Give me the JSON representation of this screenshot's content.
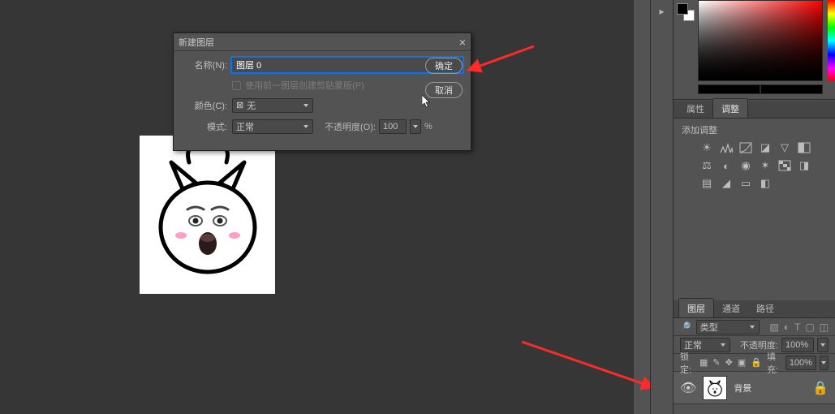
{
  "dialog": {
    "title": "新建图层",
    "name_label": "名称(N):",
    "name_value": "图层 0",
    "clip_checkbox_label": "使用前一图层创建剪贴蒙版(P)",
    "color_label": "颜色(C):",
    "color_value": "无",
    "mode_label": "模式:",
    "mode_value": "正常",
    "opacity_label": "不透明度(O):",
    "opacity_value": "100",
    "opacity_unit": "%",
    "ok": "确定",
    "cancel": "取消"
  },
  "properties_panel": {
    "tabs": [
      "属性",
      "调整"
    ],
    "add_label": "添加调整"
  },
  "layers_panel": {
    "tabs": [
      "图层",
      "通道",
      "路径"
    ],
    "kind_label": "类型",
    "blend_mode": "正常",
    "opacity_label": "不透明度:",
    "opacity_value": "100%",
    "lock_label": "锁定:",
    "fill_label": "填充:",
    "fill_value": "100%",
    "layer": {
      "name": "背景"
    }
  }
}
